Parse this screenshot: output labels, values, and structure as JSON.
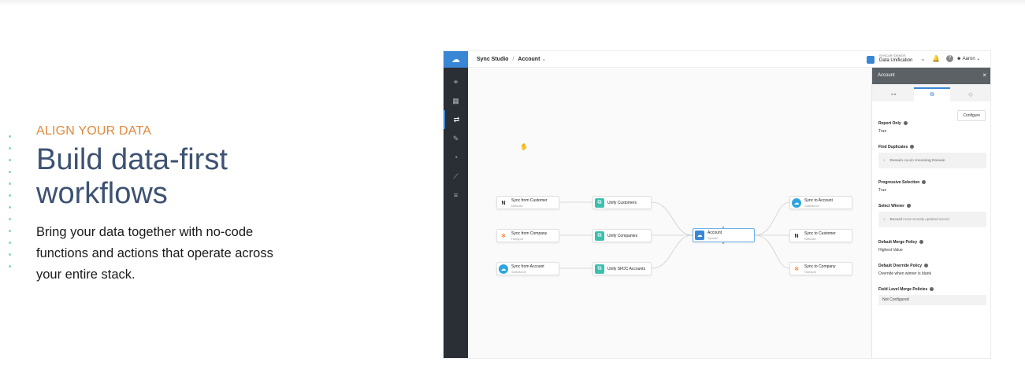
{
  "hero": {
    "eyebrow": "ALIGN YOUR DATA",
    "headline_line1": "Build data-first",
    "headline_line2": "workflows",
    "body_line1": "Bring your data together with no-code",
    "body_line2": "functions and actions that operate across",
    "body_line3": "your entire stack."
  },
  "app": {
    "breadcrumb": {
      "root": "Sync Studio",
      "separator": "/",
      "current": "Account"
    },
    "org": {
      "name": "SYNCARI DEMOS",
      "workspace": "Data Unification"
    },
    "user": "Aaron",
    "brand_color": "#3a86d6",
    "sidebar_icons": [
      "graph-icon",
      "table-icon",
      "flow-icon",
      "db-edit-icon",
      "speed-icon",
      "chart-icon",
      "list-icon"
    ]
  },
  "canvas": {
    "nodes": [
      {
        "title": "Sync from Customer",
        "subtitle": "Netsuite"
      },
      {
        "title": "Sync from Company",
        "subtitle": "Hubspot"
      },
      {
        "title": "Sync from Account",
        "subtitle": "Salesforce"
      },
      {
        "title": "Unify Customers",
        "subtitle": ""
      },
      {
        "title": "Unify Companies",
        "subtitle": ""
      },
      {
        "title": "Unify SFDC Accounts",
        "subtitle": ""
      },
      {
        "title": "Account",
        "subtitle": "Syncari"
      },
      {
        "title": "Sync to Account",
        "subtitle": "Salesforce"
      },
      {
        "title": "Sync to Customer",
        "subtitle": "Netsuite"
      },
      {
        "title": "Sync to Company",
        "subtitle": "Hubspot"
      }
    ]
  },
  "panel": {
    "title": "Account",
    "configure_label": "Configure",
    "fields": [
      {
        "label": "Report Only",
        "value": "True"
      },
      {
        "label": "Find Duplicates",
        "num": "1",
        "key": "Domain",
        "op": "equals",
        "target": "Incoming Domain"
      },
      {
        "label": "Progressive Selection",
        "value": "True"
      },
      {
        "label": "Select Winner",
        "num": "1",
        "key": "Record",
        "op": "most recently updated record"
      },
      {
        "label": "Default Merge Policy",
        "value": "Highest Value"
      },
      {
        "label": "Default Override Policy",
        "value": "Override when winner is blank"
      },
      {
        "label": "Field Level Merge Policies",
        "value": "Not Configured"
      }
    ]
  }
}
